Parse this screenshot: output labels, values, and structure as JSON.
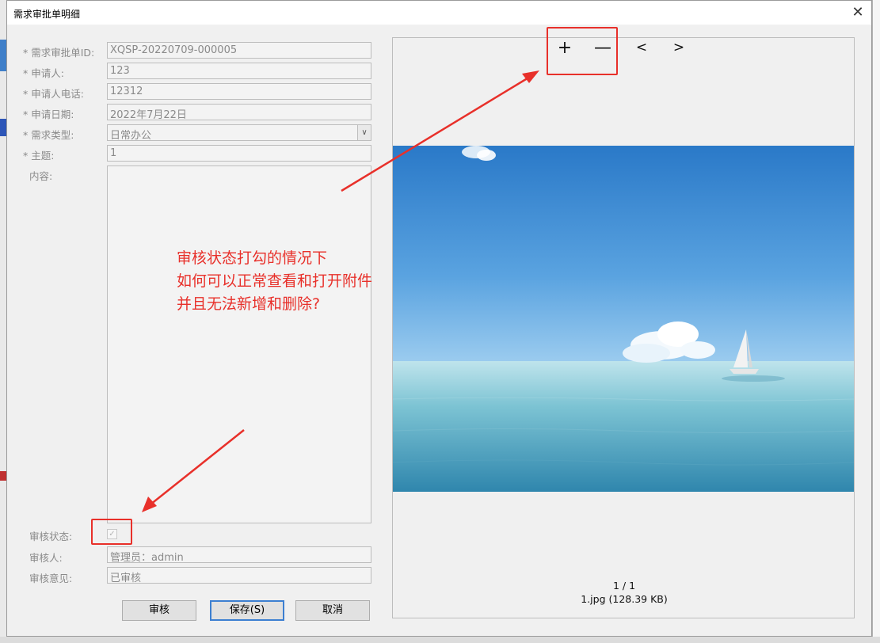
{
  "dialog": {
    "title": "需求审批单明细",
    "close_glyph": "✕"
  },
  "form": {
    "fields": [
      {
        "label": "* 需求审批单ID:",
        "value": "XQSP-20220709-000005"
      },
      {
        "label": "* 申请人:",
        "value": "123"
      },
      {
        "label": "* 申请人电话:",
        "value": "12312"
      },
      {
        "label": "* 申请日期:",
        "value": "2022年7月22日"
      },
      {
        "label": "* 需求类型:",
        "value": "日常办公"
      },
      {
        "label": "* 主题:",
        "value": "1"
      }
    ],
    "content_label": "内容:",
    "review_status_label": "审核状态:",
    "review_status_checked": true,
    "reviewer_label": "审核人:",
    "reviewer_value": "管理员：admin",
    "opinion_label": "审核意见:",
    "opinion_value": "已审核"
  },
  "buttons": {
    "review": "审核",
    "save": "保存(S)",
    "cancel": "取消"
  },
  "viewer": {
    "zoom_in": "+",
    "zoom_out": "—",
    "prev": "<",
    "next": ">",
    "page_indicator": "1 / 1",
    "file_info": "1.jpg (128.39 KB)"
  },
  "annotation": {
    "lines": [
      "审核状态打勾的情况下",
      "如何可以正常查看和打开附件",
      "并且无法新增和删除?"
    ],
    "color": "#e8302a"
  },
  "colors": {
    "dialog_bg": "#f0f0f0",
    "field_border": "#bdbdbd",
    "annotation_red": "#e8302a",
    "default_button_border": "#3c7fd1"
  }
}
